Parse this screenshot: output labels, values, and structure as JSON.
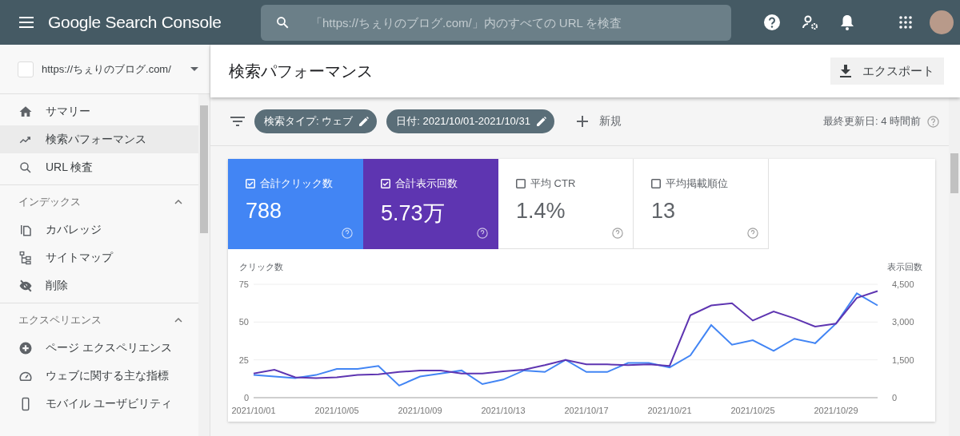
{
  "app_bar": {
    "product": "Google Search Console",
    "search": {
      "placeholder": "「https://ちぇりのブログ.com/」内のすべての URL を検査"
    }
  },
  "sidebar": {
    "property": "https://ちぇりのブログ.com/",
    "groups": [
      {
        "items": [
          {
            "label": "サマリー",
            "selected": false
          },
          {
            "label": "検索パフォーマンス",
            "selected": true
          },
          {
            "label": "URL 検査",
            "selected": false
          }
        ]
      },
      {
        "title": "インデックス",
        "expanded": true,
        "items": [
          {
            "label": "カバレッジ",
            "selected": false
          },
          {
            "label": "サイトマップ",
            "selected": false
          },
          {
            "label": "削除",
            "selected": false
          }
        ]
      },
      {
        "title": "エクスペリエンス",
        "expanded": true,
        "items": [
          {
            "label": "ページ エクスペリエンス",
            "selected": false
          },
          {
            "label": "ウェブに関する主な指標",
            "selected": false
          },
          {
            "label": "モバイル ユーザビリティ",
            "selected": false
          }
        ]
      }
    ]
  },
  "header": {
    "title": "検索パフォーマンス",
    "export_button": "エクスポート"
  },
  "filters": {
    "chips": [
      "検索タイプ: ウェブ",
      "日付: 2021/10/01-2021/10/31"
    ],
    "new_button": "新規",
    "last_updated": "最終更新日: 4 時間前"
  },
  "metrics": [
    {
      "label": "合計クリック数",
      "value": "788",
      "checked": true,
      "color": "#4285f4"
    },
    {
      "label": "合計表示回数",
      "value": "5.73万",
      "checked": true,
      "color": "#5e35b1"
    },
    {
      "label": "平均 CTR",
      "value": "1.4%",
      "checked": false
    },
    {
      "label": "平均掲載順位",
      "value": "13",
      "checked": false
    }
  ],
  "chart": {
    "chart_data": {
      "type": "line",
      "ylabel": "クリック数",
      "y2label": "表示回数",
      "categories": [
        "2021/10/01",
        null,
        null,
        null,
        "2021/10/05",
        null,
        null,
        null,
        "2021/10/09",
        null,
        null,
        null,
        "2021/10/13",
        null,
        null,
        null,
        "2021/10/17",
        null,
        null,
        null,
        "2021/10/21",
        null,
        null,
        null,
        "2021/10/25",
        null,
        null,
        null,
        "2021/10/29",
        null,
        null
      ],
      "ylim": [
        0,
        75
      ],
      "yticks": [
        0,
        25,
        50,
        75
      ],
      "y2lim": [
        0,
        4500
      ],
      "y2ticks": [
        {
          "value": 0,
          "label": "0"
        },
        {
          "value": 1500,
          "label": "1,500"
        },
        {
          "value": 3000,
          "label": "3,000"
        },
        {
          "value": 4500,
          "label": "4,500"
        }
      ],
      "series": [
        {
          "color": "#4285f4",
          "values": [
            15,
            14,
            13,
            15,
            19,
            19,
            21,
            8,
            14,
            16,
            18,
            9,
            12,
            18,
            17,
            25,
            17,
            17,
            23,
            23,
            20,
            28,
            48,
            35,
            38,
            31,
            39,
            36,
            49,
            69,
            61
          ]
        },
        {
          "color": "#5e35b1",
          "axis": "y2",
          "values": [
            960,
            1110,
            810,
            780,
            810,
            900,
            930,
            1020,
            1080,
            1080,
            960,
            960,
            1050,
            1110,
            1290,
            1500,
            1320,
            1320,
            1290,
            1320,
            1260,
            3270,
            3660,
            3750,
            3060,
            3420,
            3150,
            2820,
            2940,
            3960,
            4230
          ]
        }
      ]
    }
  }
}
